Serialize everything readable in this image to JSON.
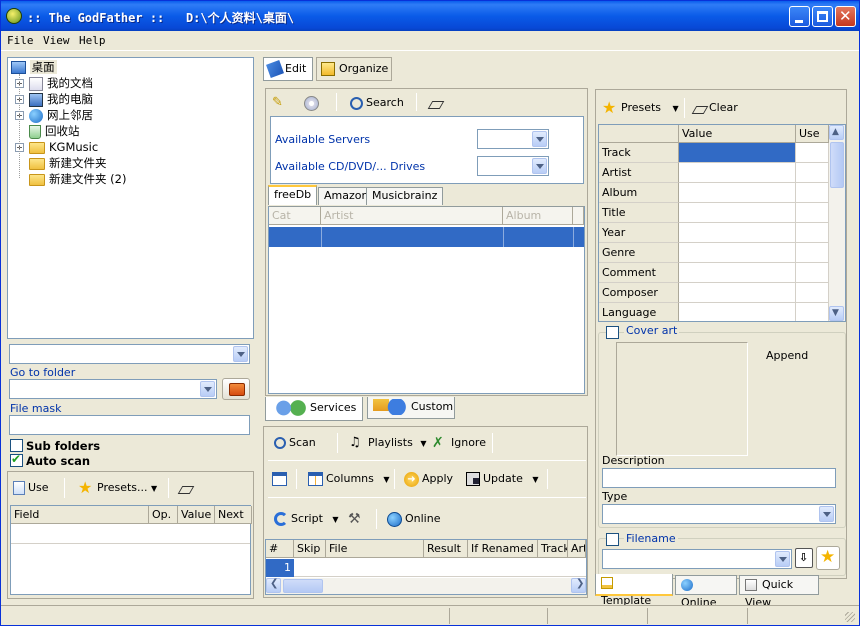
{
  "window": {
    "title": ":: The GodFather ::   D:\\个人资料\\桌面\\"
  },
  "menu": [
    "File",
    "View",
    "Help"
  ],
  "tree": {
    "root": "桌面",
    "items": [
      {
        "label": "我的文档",
        "expandable": true,
        "icon": "my-documents-icon"
      },
      {
        "label": "我的电脑",
        "expandable": true,
        "icon": "my-computer-icon"
      },
      {
        "label": "网上邻居",
        "expandable": true,
        "icon": "network-icon"
      },
      {
        "label": "回收站",
        "expandable": false,
        "icon": "recycle-bin-icon"
      },
      {
        "label": "KGMusic",
        "expandable": true,
        "icon": "folder-icon"
      },
      {
        "label": "新建文件夹",
        "expandable": false,
        "icon": "folder-icon"
      },
      {
        "label": "新建文件夹 (2)",
        "expandable": false,
        "icon": "folder-icon"
      }
    ]
  },
  "left": {
    "goto_label": "Go to folder",
    "filemask_label": "File mask",
    "subfolders_label": "Sub folders",
    "subfolders_checked": false,
    "autoscan_label": "Auto scan",
    "autoscan_checked": true,
    "use_label": "Use",
    "presets_label": "Presets...",
    "columns": [
      "Field",
      "Op.",
      "Value",
      "Next"
    ]
  },
  "center": {
    "edit_label": "Edit",
    "organize_label": "Organize",
    "search_label": "Search",
    "servers_label": "Available Servers",
    "drives_label": "Available CD/DVD/... Drives",
    "tabs": [
      "freeDb",
      "Amazon",
      "Musicbrainz"
    ],
    "result_columns": [
      "Cat",
      "Artist",
      "Album"
    ],
    "bottom_tabs": [
      "Services",
      "Custom"
    ],
    "scan_label": "Scan",
    "playlists_label": "Playlists",
    "ignore_label": "Ignore",
    "columns_label": "Columns",
    "apply_label": "Apply",
    "update_label": "Update",
    "script_label": "Script",
    "online_label": "Online",
    "file_columns": [
      "#",
      "Skip",
      "File",
      "Result",
      "If Renamed",
      "Track",
      "Artis"
    ],
    "first_row_num": "1"
  },
  "right": {
    "presets_label": "Presets",
    "clear_label": "Clear",
    "columns": [
      "Value",
      "Use"
    ],
    "fields": [
      "Track",
      "Artist",
      "Album",
      "Title",
      "Year",
      "Genre",
      "Comment",
      "Composer",
      "Language"
    ],
    "coverart_label": "Cover art",
    "append_label": "Append",
    "description_label": "Description",
    "type_label": "Type",
    "filename_label": "Filename",
    "bottom_tabs": [
      "Template",
      "Online",
      "Quick View"
    ]
  },
  "colors": {
    "selection": "#316ac5",
    "titlebar": "#0a5be8",
    "link_blue": "#0033aa"
  }
}
